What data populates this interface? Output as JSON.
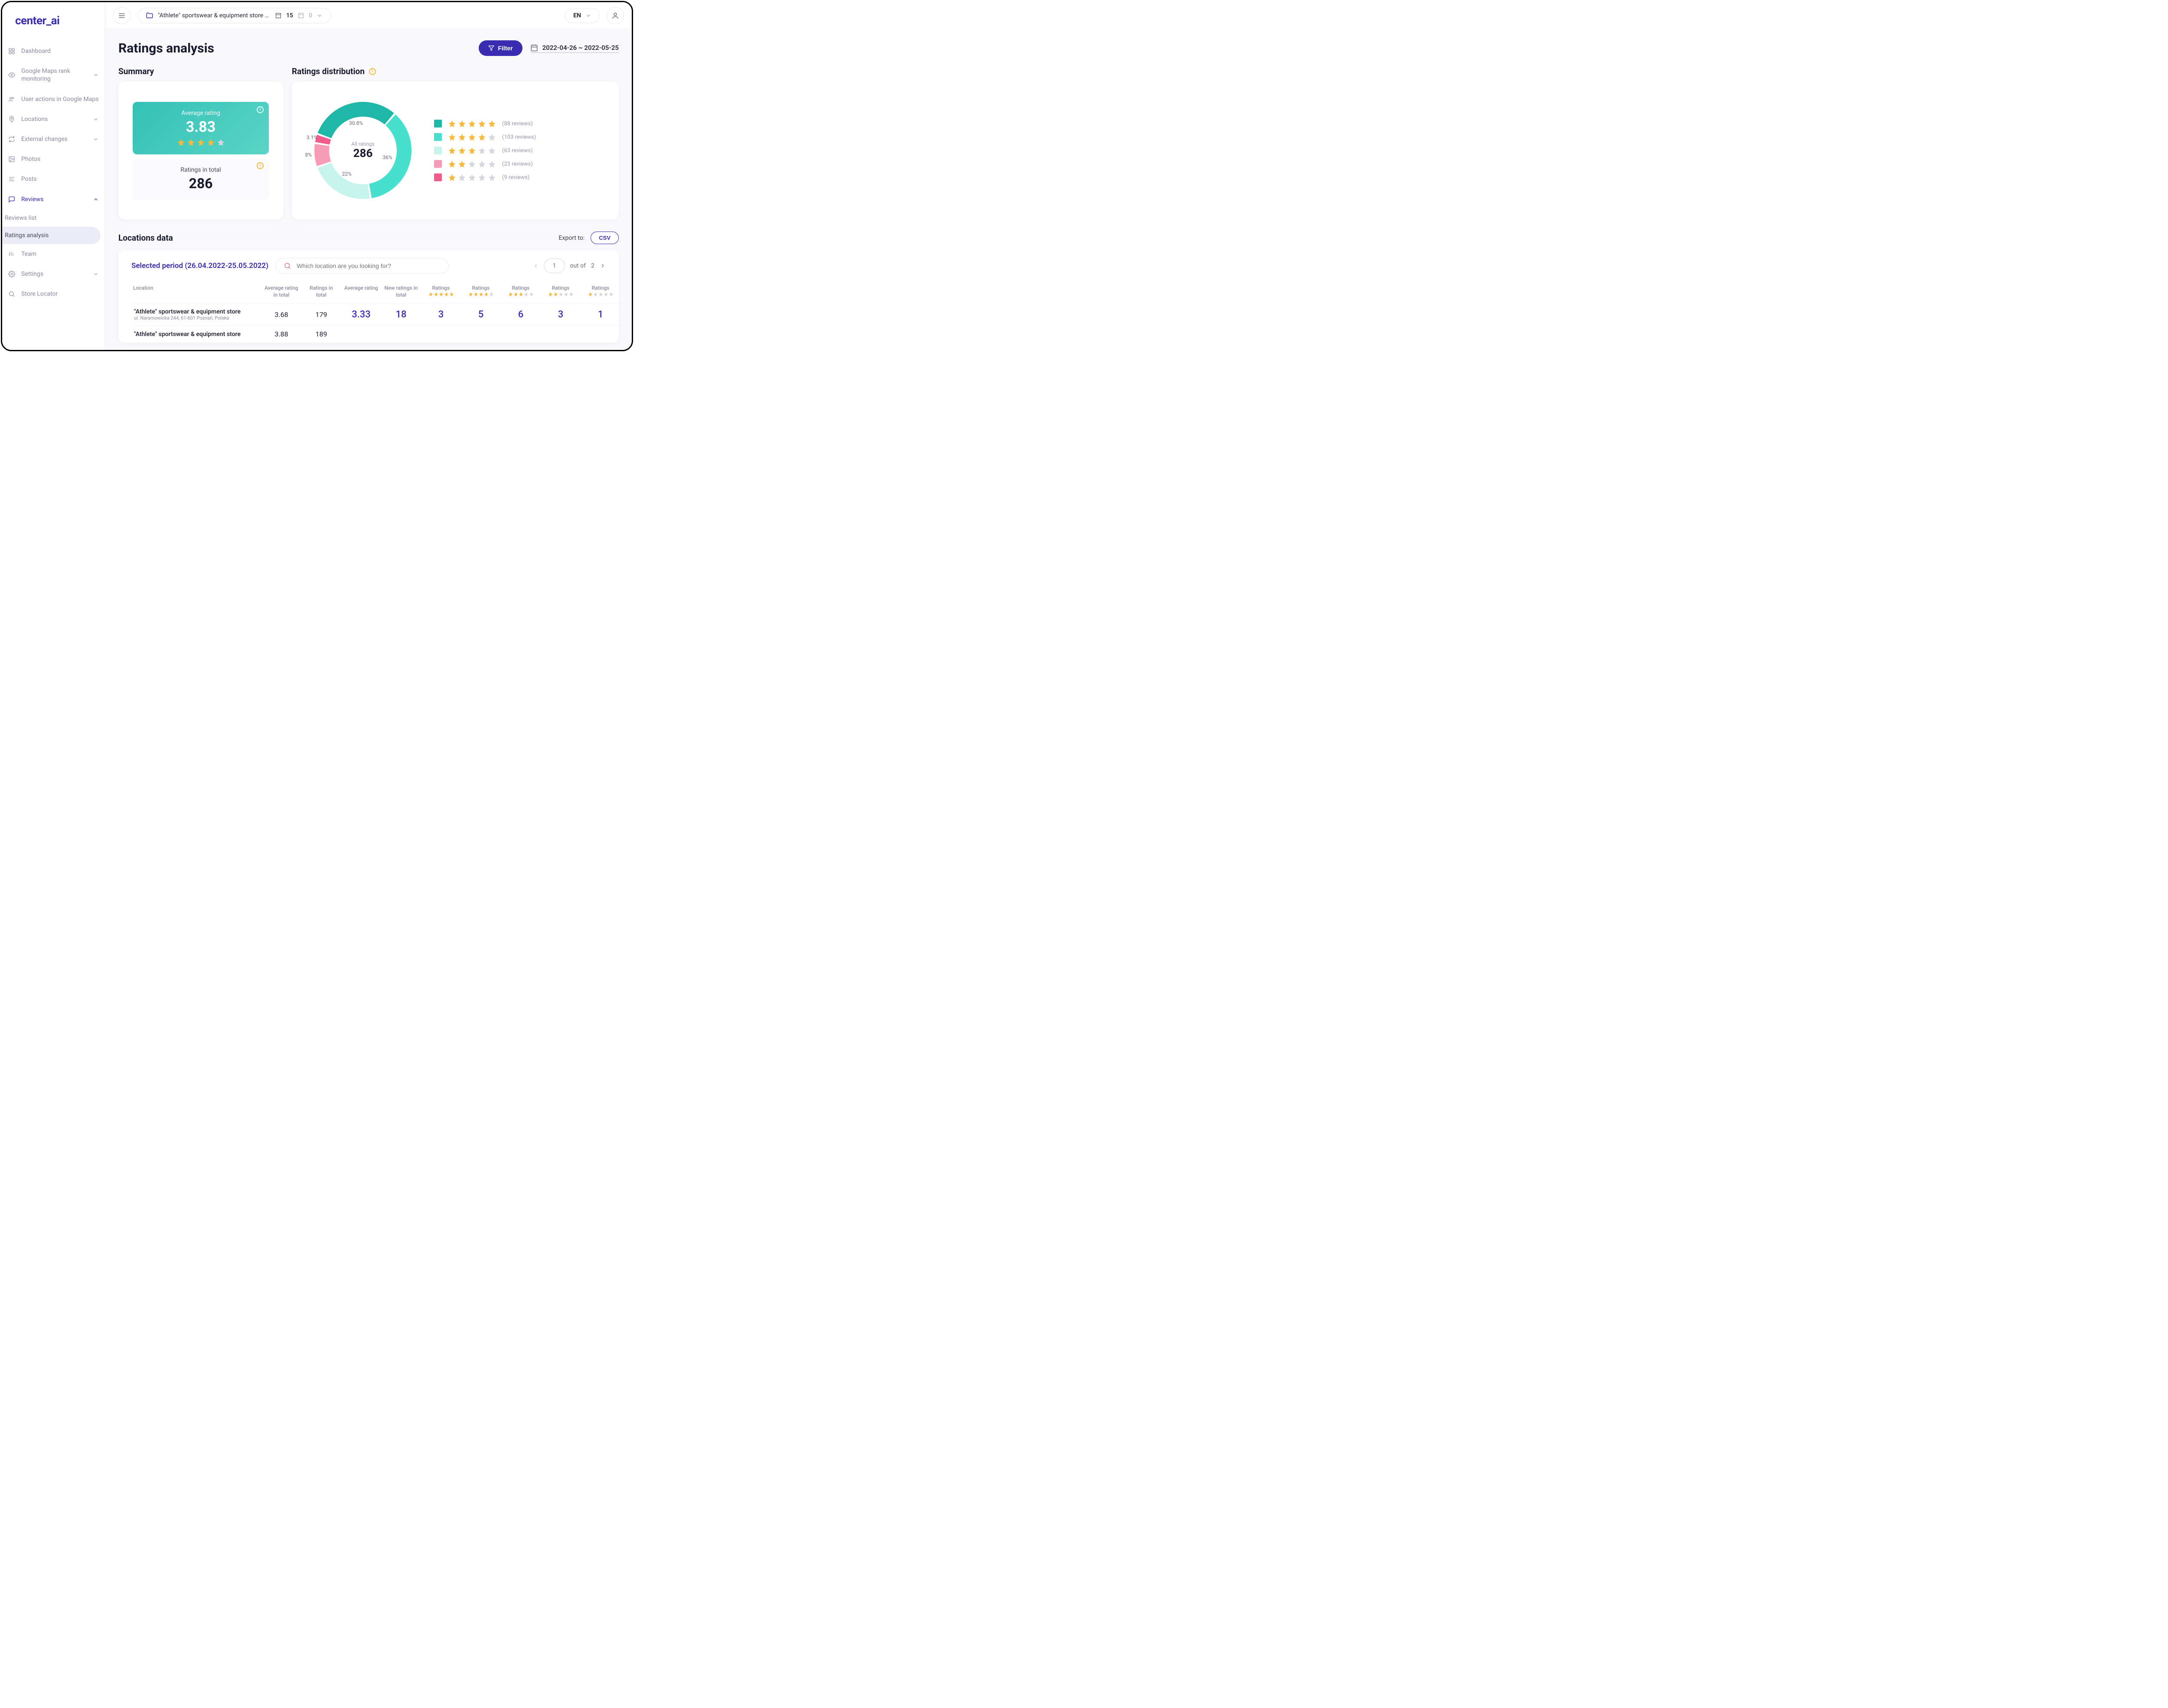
{
  "brand": "center_ai",
  "nav": {
    "dashboard": "Dashboard",
    "rank": "Google Maps rank monitoring",
    "user_actions": "User actions in Google Maps",
    "locations": "Locations",
    "external": "External changes",
    "photos": "Photos",
    "posts": "Posts",
    "reviews": "Reviews",
    "reviews_list": "Reviews list",
    "ratings_analysis": "Ratings analysis",
    "team": "Team",
    "settings": "Settings",
    "store_locator": "Store Locator"
  },
  "topbar": {
    "store_name": "\"Athlete\" sportswear & equipment store (Ow...",
    "count1": "15",
    "count2": "0",
    "lang": "EN"
  },
  "page": {
    "title": "Ratings analysis",
    "filter_label": "Filter",
    "date_range": "2022-04-26 ~ 2022-05-25"
  },
  "summary": {
    "heading": "Summary",
    "avg_label": "Average rating",
    "avg_value": "3.83",
    "avg_stars_filled": 4,
    "total_label": "Ratings in total",
    "total_value": "286"
  },
  "distribution": {
    "heading": "Ratings distribution",
    "center_label": "All ratings",
    "center_value": "286",
    "segments": [
      {
        "stars": 5,
        "pct": 30.8,
        "label": "30.8%",
        "reviews": 88,
        "color": "#1fb8a8"
      },
      {
        "stars": 4,
        "pct": 36.0,
        "label": "36%",
        "reviews": 103,
        "color": "#47e0ce"
      },
      {
        "stars": 3,
        "pct": 22.0,
        "label": "22%",
        "reviews": 63,
        "color": "#c6f3ec"
      },
      {
        "stars": 2,
        "pct": 8.0,
        "label": "8%",
        "reviews": 23,
        "color": "#f79bb6"
      },
      {
        "stars": 1,
        "pct": 3.1,
        "label": "3.1%",
        "reviews": 9,
        "color": "#f25c8a"
      }
    ],
    "reviews_suffix": "reviews"
  },
  "locations": {
    "heading": "Locations data",
    "export_label": "Export to:",
    "csv_label": "CSV",
    "period": "Selected period (26.04.2022-25.05.2022)",
    "search_placeholder": "Which location are you looking for?",
    "page_current": "1",
    "out_of_label": "out of",
    "page_total": "2",
    "columns": [
      {
        "label": "Location",
        "type": "text"
      },
      {
        "label": "Average rating in total",
        "type": "num"
      },
      {
        "label": "Ratings in total",
        "type": "num"
      },
      {
        "label": "Average rating",
        "type": "hl"
      },
      {
        "label": "New ratings in total",
        "type": "hl"
      },
      {
        "label": "Ratings",
        "type": "hl",
        "stars": 5
      },
      {
        "label": "Ratings",
        "type": "hl",
        "stars": 4
      },
      {
        "label": "Ratings",
        "type": "hl",
        "stars": 3
      },
      {
        "label": "Ratings",
        "type": "hl",
        "stars": 2
      },
      {
        "label": "Ratings",
        "type": "hl",
        "stars": 1
      }
    ],
    "rows": [
      {
        "name": "\"Athlete\" sportswear & equipment store",
        "address": "ul. Naramowicka 244, 61-601 Poznań, Polska",
        "cells": [
          "3.68",
          "179",
          "3.33",
          "18",
          "3",
          "5",
          "6",
          "3",
          "1"
        ]
      },
      {
        "name": "\"Athlete\" sportswear & equipment store",
        "address": "",
        "cells": [
          "3.88",
          "189",
          "",
          "",
          "",
          "",
          "",
          "",
          ""
        ]
      }
    ]
  },
  "colors": {
    "star_on": "#f6b93b",
    "star_off": "#d6d6de"
  },
  "chart_data": {
    "type": "pie",
    "title": "Ratings distribution",
    "center_label": "All ratings",
    "total": 286,
    "series": [
      {
        "name": "5 stars",
        "value": 88,
        "pct": 30.8,
        "color": "#1fb8a8"
      },
      {
        "name": "4 stars",
        "value": 103,
        "pct": 36.0,
        "color": "#47e0ce"
      },
      {
        "name": "3 stars",
        "value": 63,
        "pct": 22.0,
        "color": "#c6f3ec"
      },
      {
        "name": "2 stars",
        "value": 23,
        "pct": 8.0,
        "color": "#f79bb6"
      },
      {
        "name": "1 star",
        "value": 9,
        "pct": 3.1,
        "color": "#f25c8a"
      }
    ]
  }
}
